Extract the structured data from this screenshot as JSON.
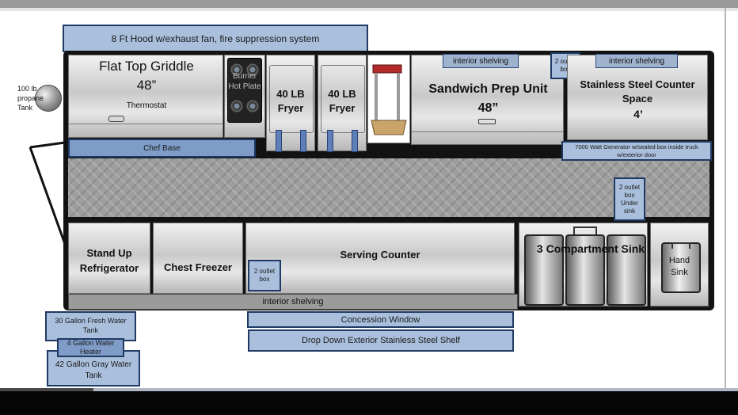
{
  "hood": "8 Ft Hood w/exhaust fan, fire suppression system",
  "propane": "100 lb propane Tank",
  "griddle": {
    "title": "Flat Top Griddle",
    "size": "48”",
    "thermostat": "Thermostat"
  },
  "hot_plate": "Burner Hot Plate",
  "fryer_1": "40 LB Fryer",
  "fryer_2": "40 LB Fryer",
  "chef_base": "Chef Base",
  "interior_shelving_top_1": "interior shelving",
  "outlet_top": "2 outlet box",
  "interior_shelving_top_2": "interior shelving",
  "sandwich_prep": {
    "title": "Sandwich Prep Unit",
    "size": "48”"
  },
  "counter_space": {
    "title": "Stainless Steel Counter Space",
    "size": "4’"
  },
  "generator": "7000 Watt Generator w/sealed box inside truck w/exterior door",
  "outlet_under_sink": "2 outlet box Under sink",
  "stand_up_fridge": "Stand Up Refrigerator",
  "chest_freezer": "Chest Freezer",
  "serving_counter": "Serving Counter",
  "outlet_counter": "2 outlet box",
  "compartment_sink": "3 Compartment Sink",
  "hand_sink": "Hand Sink",
  "interior_shelving_bottom": "interior shelving",
  "fresh_water": "30 Gallon Fresh Water Tank",
  "water_heater": "4 Gallon Water Heater",
  "gray_water": "42 Gallon Gray Water Tank",
  "concession_window": "Concession Window",
  "exterior_shelf": "Drop Down Exterior Stainless Steel Shelf"
}
